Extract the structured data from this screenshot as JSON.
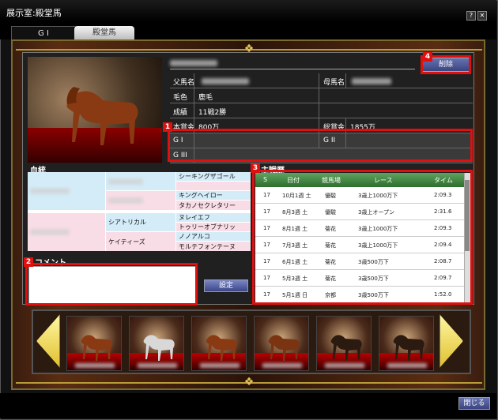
{
  "window": {
    "title": "展示室:殿堂馬",
    "help_btn": "?",
    "close_btn": "✕"
  },
  "tabs": [
    {
      "label": "G I"
    },
    {
      "label": "殿堂馬"
    }
  ],
  "profile": {
    "delete_label": "削除",
    "sire_label": "父馬名",
    "dam_label": "母馬名",
    "coat_label": "毛色",
    "coat_value": "鹿毛",
    "record_label": "成績",
    "record_value": "11戦2勝",
    "prize_label": "本賞金",
    "prize_value": "800万",
    "total_label": "総賞金",
    "total_value": "1855万",
    "g1_label": "G I",
    "g2_label": "G II",
    "g3_label": "G III"
  },
  "pedigree": {
    "title": "血統",
    "gsire_cells": [
      "シーキングザゴール",
      "キングヘイロー",
      "タカノセクレタリー",
      "ヌレイエフ",
      "トゥリーオブナリッ",
      "ノノアルコ",
      "モルテフォンテーヌ"
    ],
    "mid_cells": [
      "シアトリカル",
      "ケイティーズ"
    ]
  },
  "comment": {
    "title": "コメント",
    "set_label": "設定"
  },
  "races": {
    "title": "主戦歴",
    "headers": [
      "S",
      "日付",
      "競馬場",
      "レース",
      "タイム"
    ],
    "rows": [
      {
        "s": "17",
        "date": "10月1週 土",
        "course": "優駿",
        "race": "3歳上1000万下",
        "time": "2:09.3"
      },
      {
        "s": "17",
        "date": "8月3週 土",
        "course": "優駿",
        "race": "3歳上オープン",
        "time": "2:31.6"
      },
      {
        "s": "17",
        "date": "8月1週 土",
        "course": "菊花",
        "race": "3歳上1000万下",
        "time": "2:09.3"
      },
      {
        "s": "17",
        "date": "7月3週 土",
        "course": "菊花",
        "race": "3歳上1000万下",
        "time": "2:09.4"
      },
      {
        "s": "17",
        "date": "6月1週 土",
        "course": "菊花",
        "race": "3歳500万下",
        "time": "2:08.7"
      },
      {
        "s": "17",
        "date": "5月3週 土",
        "course": "菊花",
        "race": "3歳500万下",
        "time": "2:09.7"
      },
      {
        "s": "17",
        "date": "5月1週 日",
        "course": "京都",
        "race": "3歳500万下",
        "time": "1:52.0"
      }
    ]
  },
  "annotations": [
    "1",
    "2",
    "3",
    "4"
  ],
  "footer": {
    "close_label": "閉じる"
  }
}
